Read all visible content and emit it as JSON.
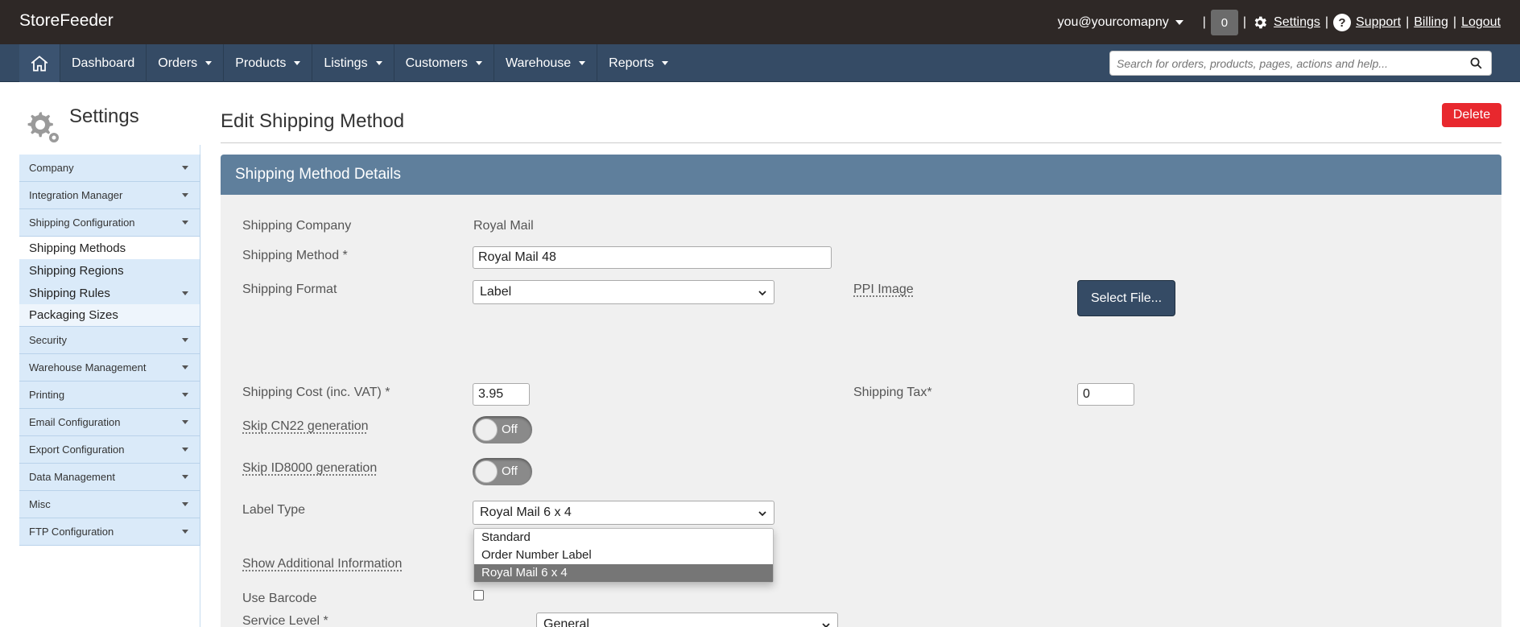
{
  "header": {
    "brand": "StoreFeeder",
    "user": "you@yourcomapny",
    "notifications": "0",
    "links": {
      "settings": "Settings",
      "support": "Support",
      "billing": "Billing",
      "logout": "Logout"
    },
    "sep": "|"
  },
  "nav": {
    "items": [
      {
        "label": "Dashboard"
      },
      {
        "label": "Orders"
      },
      {
        "label": "Products"
      },
      {
        "label": "Listings"
      },
      {
        "label": "Customers"
      },
      {
        "label": "Warehouse"
      },
      {
        "label": "Reports"
      }
    ],
    "search_placeholder": "Search for orders, products, pages, actions and help..."
  },
  "sidebar": {
    "title": "Settings",
    "items": [
      "Company",
      "Integration Manager",
      "Shipping Configuration",
      "Shipping Methods",
      "Shipping Regions",
      "Shipping Rules",
      "Packaging Sizes",
      "Security",
      "Warehouse Management",
      "Printing",
      "Email Configuration",
      "Export Configuration",
      "Data Management",
      "Misc",
      "FTP Configuration"
    ]
  },
  "main": {
    "title": "Edit Shipping Method",
    "delete_label": "Delete",
    "panel_title": "Shipping Method Details",
    "fields": {
      "shipping_company_label": "Shipping Company",
      "shipping_company_value": "Royal Mail",
      "shipping_method_label": "Shipping Method *",
      "shipping_method_value": "Royal Mail 48",
      "shipping_format_label": "Shipping Format",
      "shipping_format_value": "Label",
      "ppi_image_label": "PPI Image",
      "select_file_label": "Select File...",
      "shipping_cost_label": "Shipping Cost (inc. VAT) *",
      "shipping_cost_value": "3.95",
      "shipping_tax_label": "Shipping Tax*",
      "shipping_tax_value": "0",
      "skip_cn22_label": "Skip CN22 generation",
      "skip_id8000_label": "Skip ID8000 generation",
      "toggle_off": "Off",
      "label_type_label": "Label Type",
      "label_type_value": "Royal Mail 6 x 4",
      "label_type_options": [
        "Standard",
        "Order Number Label",
        "Royal Mail 6 x 4"
      ],
      "show_additional_label": "Show Additional Information",
      "use_barcode_label": "Use Barcode",
      "service_level_label": "Service Level *",
      "service_level_value": "General"
    }
  },
  "colors": {
    "topbar": "#2e2826",
    "navbar": "#354b65",
    "panel_head": "#5f7f9c",
    "delete": "#e8282e",
    "sidebar_item": "#daeaf9"
  }
}
